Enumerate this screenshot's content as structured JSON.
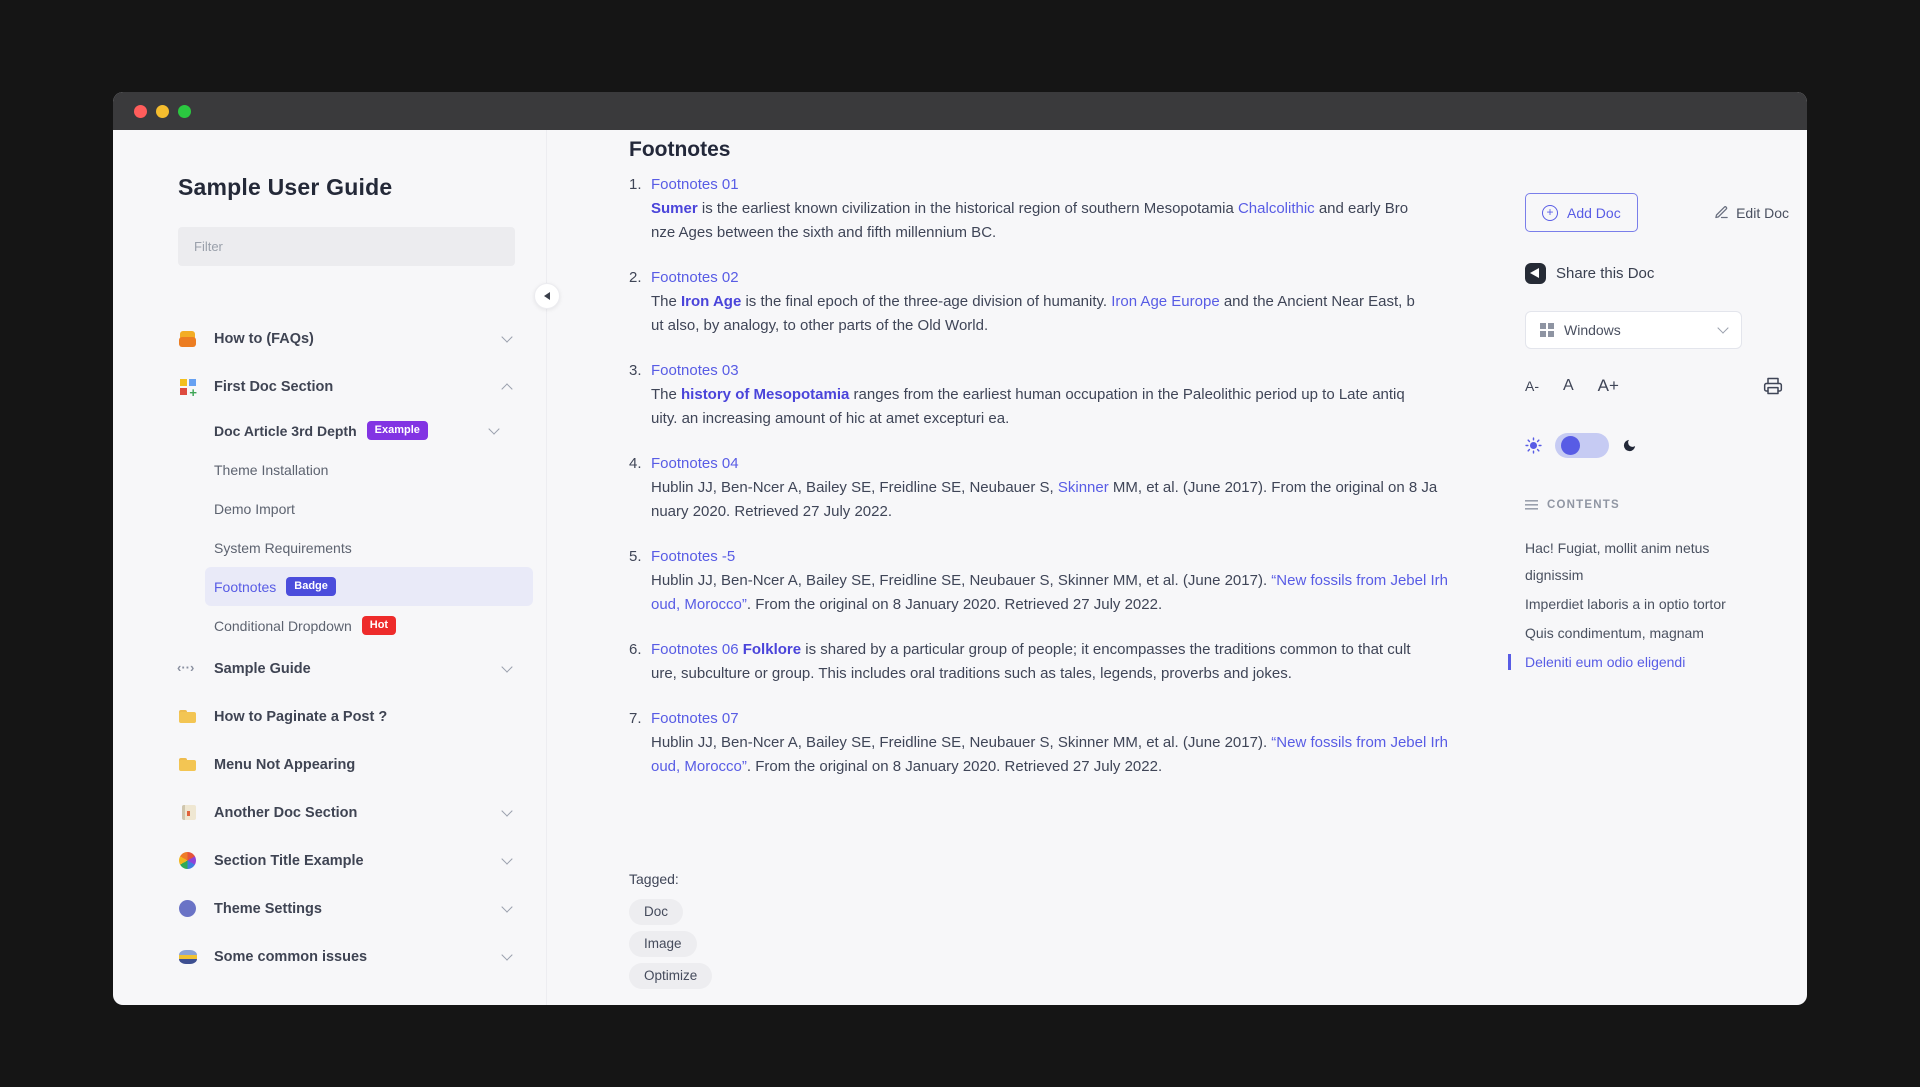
{
  "colors": {
    "accent": "#585ce5",
    "accent-bold": "#4a44da",
    "badge-purple": "#8234e3",
    "badge-indigo": "#4b4ddc",
    "badge-red": "#ee2b2b",
    "traffic-red": "#ff5d5b",
    "traffic-yellow": "#f5bd2e",
    "traffic-green": "#2bc840",
    "titlebar": "#3a3a3c",
    "window-bg": "#f7f7f9"
  },
  "sidebar": {
    "title": "Sample User Guide",
    "filter_placeholder": "Filter",
    "items": [
      {
        "label": "How to (FAQs)",
        "icon": "faq",
        "level": 0,
        "bold": true,
        "chevron": "down"
      },
      {
        "label": "First Doc Section",
        "icon": "grid",
        "level": 0,
        "bold": true,
        "chevron": "up"
      },
      {
        "label": "Doc Article 3rd Depth",
        "level": 1,
        "bold": true,
        "chevron": "down",
        "badge": {
          "text": "Example",
          "color": "purple"
        }
      },
      {
        "label": "Theme Installation",
        "level": 1
      },
      {
        "label": "Demo Import",
        "level": 1
      },
      {
        "label": "System Requirements",
        "level": 1
      },
      {
        "label": "Footnotes",
        "level": 1,
        "active": true,
        "badge": {
          "text": "Badge",
          "color": "indigo"
        }
      },
      {
        "label": "Conditional Dropdown",
        "level": 1,
        "badge": {
          "text": "Hot",
          "color": "red"
        }
      },
      {
        "label": "Sample Guide",
        "icon": "code",
        "level": 0,
        "bold": true,
        "chevron": "down"
      },
      {
        "label": "How to Paginate a Post ?",
        "icon": "folder",
        "level": 0,
        "bold": true
      },
      {
        "label": "Menu Not Appearing",
        "icon": "folder",
        "level": 0,
        "bold": true
      },
      {
        "label": "Another Doc Section",
        "icon": "journal",
        "level": 0,
        "bold": true,
        "chevron": "down"
      },
      {
        "label": "Section Title Example",
        "icon": "flower",
        "level": 0,
        "bold": true,
        "chevron": "down"
      },
      {
        "label": "Theme Settings",
        "icon": "circle",
        "level": 0,
        "bold": true,
        "chevron": "down"
      },
      {
        "label": "Some common issues",
        "icon": "burger",
        "level": 0,
        "bold": true,
        "chevron": "down"
      }
    ]
  },
  "main": {
    "title": "Footnotes",
    "footnotes": [
      {
        "num": "1.",
        "title": "Footnotes 01",
        "lines": [
          [
            {
              "t": "Sumer",
              "k": "b"
            },
            {
              "t": " is the earliest known civilization in the historical region of southern Mesopotamia ",
              "k": "p"
            },
            {
              "t": "Chalcolithic",
              "k": "l"
            },
            {
              "t": " and early Bro",
              "k": "p"
            }
          ],
          [
            {
              "t": "nze Ages between the sixth and fifth millennium BC.",
              "k": "p"
            }
          ]
        ]
      },
      {
        "num": "2.",
        "title": "Footnotes 02",
        "lines": [
          [
            {
              "t": "The ",
              "k": "p"
            },
            {
              "t": "Iron Age",
              "k": "b"
            },
            {
              "t": " is the final epoch of the three-age division of humanity. ",
              "k": "p"
            },
            {
              "t": "Iron Age Europe",
              "k": "l"
            },
            {
              "t": " and the Ancient Near East, b",
              "k": "p"
            }
          ],
          [
            {
              "t": "ut also, by analogy, to other parts of the Old World.",
              "k": "p"
            }
          ]
        ]
      },
      {
        "num": "3.",
        "title": "Footnotes 03",
        "lines": [
          [
            {
              "t": "The ",
              "k": "p"
            },
            {
              "t": "history of Mesopotamia",
              "k": "b"
            },
            {
              "t": " ranges from the earliest human occupation in the Paleolithic period up to Late antiq",
              "k": "p"
            }
          ],
          [
            {
              "t": "uity. an increasing amount of hic at amet excepturi ea.",
              "k": "p"
            }
          ]
        ]
      },
      {
        "num": "4.",
        "title": "Footnotes 04",
        "lines": [
          [
            {
              "t": "Hublin JJ, Ben-Ncer A, Bailey SE, Freidline SE, Neubauer S, ",
              "k": "p"
            },
            {
              "t": "Skinner",
              "k": "l"
            },
            {
              "t": " MM, et al. (June 2017).  From the original on 8 Ja",
              "k": "p"
            }
          ],
          [
            {
              "t": "nuary 2020. Retrieved 27 July 2022.",
              "k": "p"
            }
          ]
        ]
      },
      {
        "num": "5.",
        "title": "Footnotes -5",
        "lines": [
          [
            {
              "t": "Hublin JJ, Ben-Ncer A, Bailey SE, Freidline SE, Neubauer S, Skinner MM, et al. (June 2017). ",
              "k": "p"
            },
            {
              "t": "“New fossils from Jebel Irh",
              "k": "l"
            }
          ],
          [
            {
              "t": "oud, Morocco”",
              "k": "l"
            },
            {
              "t": ". From the original on 8 January 2020. Retrieved 27 July 2022.",
              "k": "p"
            }
          ]
        ]
      },
      {
        "num": "6.",
        "title": null,
        "lines": [
          [
            {
              "t": "Footnotes 06",
              "k": "tl"
            },
            {
              "t": " ",
              "k": "p"
            },
            {
              "t": "Folklore",
              "k": "b"
            },
            {
              "t": " is shared by a particular group of people; it encompasses the traditions common to that cult",
              "k": "p"
            }
          ],
          [
            {
              "t": "ure, subculture or group. This includes oral traditions such as tales, legends, proverbs and jokes.",
              "k": "p"
            }
          ]
        ]
      },
      {
        "num": "7.",
        "title": "Footnotes 07",
        "lines": [
          [
            {
              "t": "Hublin JJ, Ben-Ncer A, Bailey SE, Freidline SE, Neubauer S, Skinner MM, et al. (June 2017). ",
              "k": "p"
            },
            {
              "t": "“New fossils from Jebel Irh",
              "k": "l"
            }
          ],
          [
            {
              "t": "oud, Morocco”",
              "k": "l"
            },
            {
              "t": ". From the original on 8 January 2020. Retrieved 27 July 2022.",
              "k": "p"
            }
          ]
        ]
      }
    ],
    "tagged_label": "Tagged:",
    "tags": [
      "Doc",
      "Image",
      "Optimize"
    ]
  },
  "rightbar": {
    "add_doc": "Add Doc",
    "edit_doc": "Edit Doc",
    "share": "Share this Doc",
    "platform": "Windows",
    "font_decrease": "A-",
    "font_normal": "A",
    "font_increase": "A+",
    "contents_title": "CONTENTS",
    "contents": [
      {
        "label": "Hac! Fugiat, mollit anim netus dignissim",
        "active": false
      },
      {
        "label": "Imperdiet laboris a in optio tortor",
        "active": false
      },
      {
        "label": "Quis condimentum, magnam",
        "active": false
      },
      {
        "label": "Deleniti eum odio eligendi",
        "active": true
      }
    ]
  }
}
